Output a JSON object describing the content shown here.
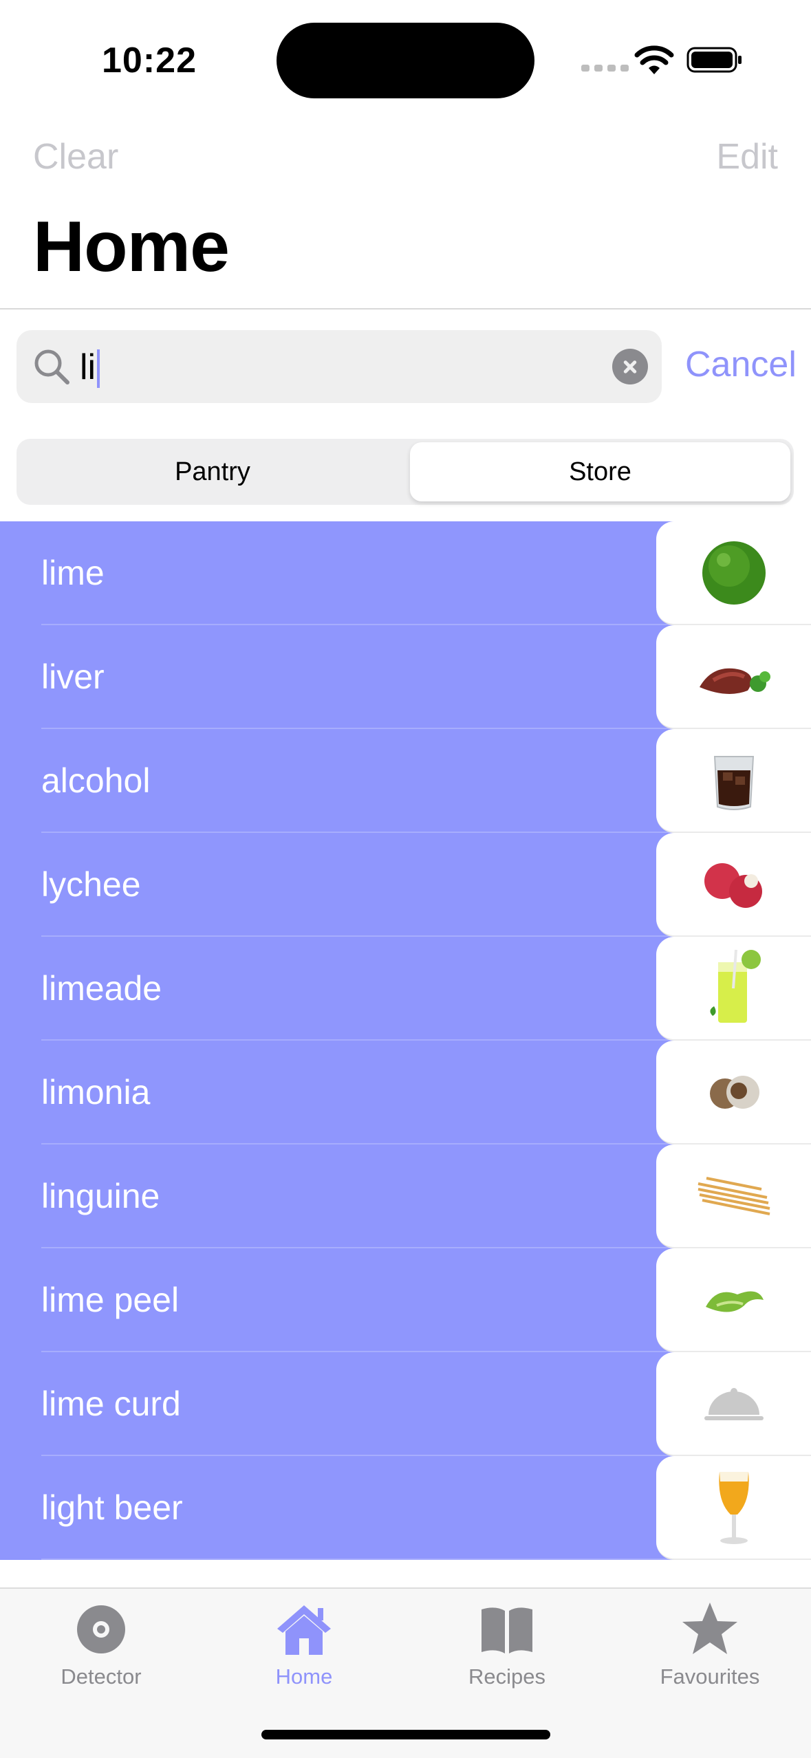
{
  "status_bar": {
    "time": "10:22"
  },
  "nav": {
    "clear_label": "Clear",
    "edit_label": "Edit",
    "title": "Home"
  },
  "search": {
    "value": "li",
    "cancel_label": "Cancel"
  },
  "segmented": {
    "options": [
      "Pantry",
      "Store"
    ],
    "selected": "Store"
  },
  "results": [
    {
      "label": "lime",
      "icon": "lime-icon"
    },
    {
      "label": "liver",
      "icon": "liver-icon"
    },
    {
      "label": "alcohol",
      "icon": "alcohol-glass-icon"
    },
    {
      "label": "lychee",
      "icon": "lychee-icon"
    },
    {
      "label": "limeade",
      "icon": "limeade-glass-icon"
    },
    {
      "label": "limonia",
      "icon": "limonia-icon"
    },
    {
      "label": "linguine",
      "icon": "linguine-icon"
    },
    {
      "label": "lime peel",
      "icon": "lime-peel-icon"
    },
    {
      "label": "lime curd",
      "icon": "cloche-placeholder-icon"
    },
    {
      "label": "light beer",
      "icon": "beer-glass-icon"
    }
  ],
  "tab_bar": {
    "tabs": [
      {
        "label": "Detector",
        "icon": "detector-icon"
      },
      {
        "label": "Home",
        "icon": "house-icon"
      },
      {
        "label": "Recipes",
        "icon": "book-icon"
      },
      {
        "label": "Favourites",
        "icon": "star-icon"
      }
    ],
    "active": "Home"
  },
  "colors": {
    "accent": "#8f93fb",
    "row_background": "#8f96fd",
    "disabled_nav": "#c7c7cc"
  }
}
